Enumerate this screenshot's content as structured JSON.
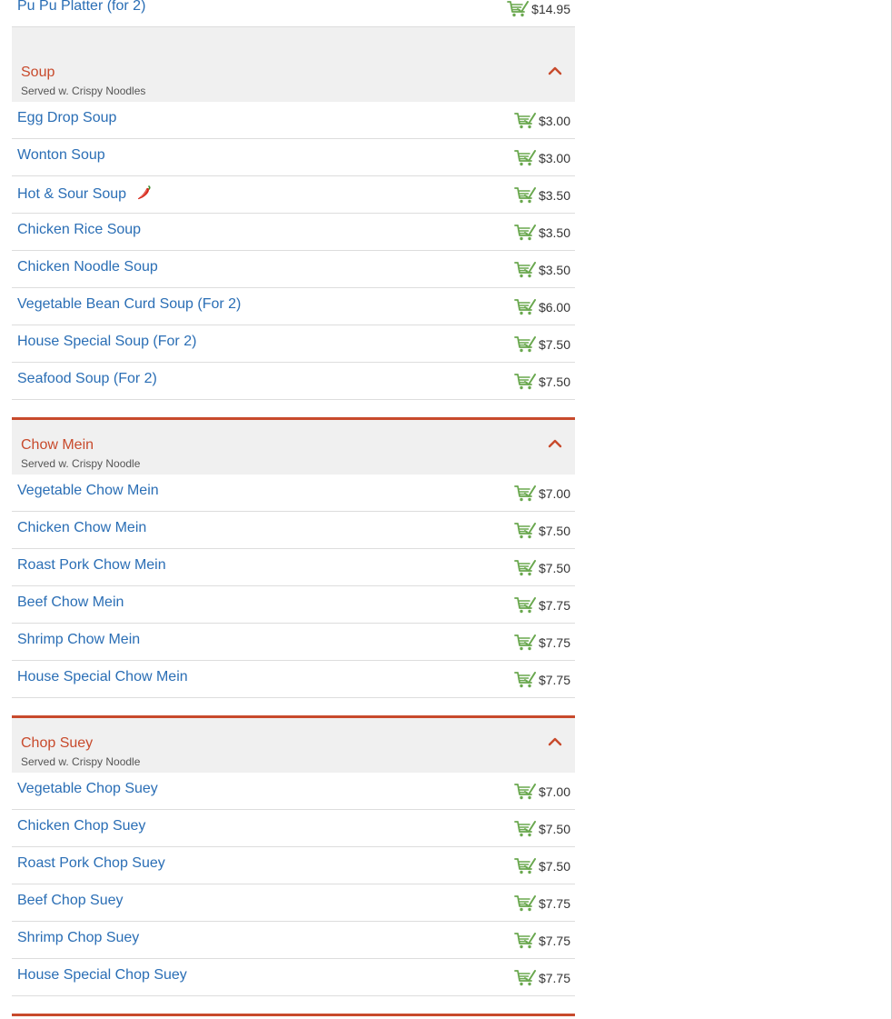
{
  "colors": {
    "link": "#2a6eb5",
    "accent": "#c84a2c",
    "cart": "#6aa84f",
    "price": "#333333"
  },
  "icons": {
    "cart": "shopping-cart-icon",
    "spicy": "chili-pepper-icon",
    "collapse": "chevron-up-icon"
  },
  "top_item": {
    "name": "Pu Pu Platter (for 2)",
    "price": "$14.95"
  },
  "categories": [
    {
      "title": "Soup",
      "subtitle": "Served w. Crispy Noodles",
      "items": [
        {
          "name": "Egg Drop Soup",
          "price": "$3.00"
        },
        {
          "name": "Wonton Soup",
          "price": "$3.00"
        },
        {
          "name": "Hot & Sour Soup",
          "price": "$3.50",
          "spicy": true
        },
        {
          "name": "Chicken Rice Soup",
          "price": "$3.50"
        },
        {
          "name": "Chicken Noodle Soup",
          "price": "$3.50"
        },
        {
          "name": "Vegetable Bean Curd Soup (For 2)",
          "price": "$6.00"
        },
        {
          "name": "House Special Soup (For 2)",
          "price": "$7.50"
        },
        {
          "name": "Seafood Soup (For 2)",
          "price": "$7.50"
        }
      ]
    },
    {
      "title": "Chow Mein",
      "subtitle": "Served w. Crispy Noodle",
      "items": [
        {
          "name": "Vegetable Chow Mein",
          "price": "$7.00"
        },
        {
          "name": "Chicken Chow Mein",
          "price": "$7.50"
        },
        {
          "name": "Roast Pork Chow Mein",
          "price": "$7.50"
        },
        {
          "name": "Beef Chow Mein",
          "price": "$7.75"
        },
        {
          "name": "Shrimp Chow Mein",
          "price": "$7.75"
        },
        {
          "name": "House Special Chow Mein",
          "price": "$7.75"
        }
      ]
    },
    {
      "title": "Chop Suey",
      "subtitle": "Served w. Crispy Noodle",
      "items": [
        {
          "name": "Vegetable Chop Suey",
          "price": "$7.00"
        },
        {
          "name": "Chicken Chop Suey",
          "price": "$7.50"
        },
        {
          "name": "Roast Pork Chop Suey",
          "price": "$7.50"
        },
        {
          "name": "Beef Chop Suey",
          "price": "$7.75"
        },
        {
          "name": "Shrimp Chop Suey",
          "price": "$7.75"
        },
        {
          "name": "House Special Chop Suey",
          "price": "$7.75"
        }
      ]
    }
  ]
}
